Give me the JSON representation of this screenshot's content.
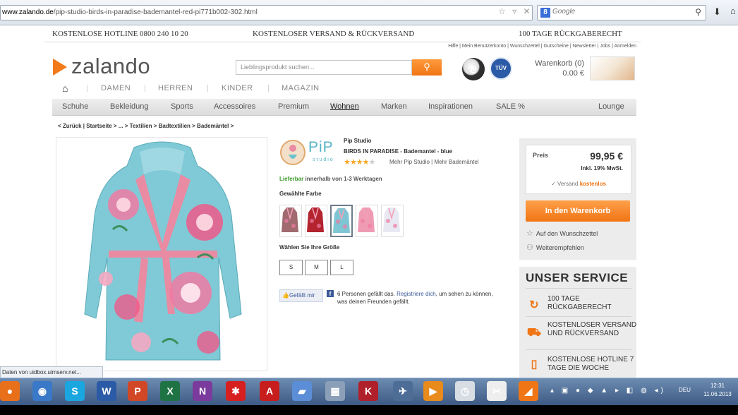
{
  "browser": {
    "url_domain": "www.zalando.de",
    "url_path": "/pip-studio-birds-in-paradise-bademantel-red-pi771b002-302.html",
    "search_engine": "Google",
    "status_text": "Daten von uidbox.uimserv.net..."
  },
  "promo": {
    "hotline": "KOSTENLOSE HOTLINE 0800 240 10 20",
    "shipping": "KOSTENLOSER VERSAND & RÜCKVERSAND",
    "return": "100 TAGE RÜCKGABERECHT"
  },
  "toplinks": "Hilfe | Mein Benutzerkonto | Wunschzettel | Gutscheine | Newsletter | Jobs | Anmelden",
  "header": {
    "logo": "zalando",
    "search_placeholder": "Lieblingsprodukt suchen...",
    "tuv_label": "TÜV",
    "e_label": "e",
    "cart_label": "Warenkorb (0)",
    "cart_amount": "0.00 €"
  },
  "category_nav": [
    "DAMEN",
    "HERREN",
    "KINDER",
    "MAGAZIN"
  ],
  "main_nav": [
    "Schuhe",
    "Bekleidung",
    "Sports",
    "Accessoires",
    "Premium",
    "Wohnen",
    "Marken",
    "Inspirationen",
    "SALE %",
    "Lounge"
  ],
  "breadcrumb": "< Zurück |  Startseite > ... > Textilien > Badtextilien > Bademäntel >",
  "product": {
    "brand_logo": "PiP",
    "brand_logo_sub": "studio",
    "brand": "Pip Studio",
    "title": "BIRDS IN PARADISE - Bademantel - blue",
    "rating": 4,
    "rating_max": 5,
    "more_links": "Mehr Pip Studio | Mehr Bademäntel",
    "availability_label": "Lieferbar",
    "availability_text": " innerhalb von 1-3 Werktagen",
    "color_label": "Gewählte Farbe",
    "size_label": "Wählen Sie Ihre Größe",
    "sizes": [
      "S",
      "M",
      "L"
    ],
    "swatch_colors": [
      "#a06a6f",
      "#b3242f",
      "#7ec6d4",
      "#f09bb4",
      "#e8e8f2"
    ],
    "selected_swatch": 2
  },
  "facebook": {
    "like_label": "Gefällt mir",
    "text_before": "6 Personen gefällt das. ",
    "link": "Registriere dich",
    "text_after": ", um sehen zu können, was deinen Freunden gefällt."
  },
  "pricebox": {
    "price_label": "Preis",
    "price": "99,95 €",
    "vat": "Inkl. 19% MwSt.",
    "shipping_label": "Versand ",
    "shipping_free": "kostenlos",
    "cart_button": "In den Warenkorb",
    "wishlist": "Auf den Wunschzettel",
    "recommend": "Weiterempfehlen"
  },
  "service": {
    "title": "UNSER SERVICE",
    "items": [
      "100 TAGE RÜCKGABERECHT",
      "KOSTENLOSER VERSAND UND RÜCKVERSAND",
      "KOSTENLOSE HOTLINE 7 TAGE DIE WOCHE"
    ]
  },
  "taskbar": {
    "apps": [
      {
        "name": "firefox-icon",
        "color": "#e8701b",
        "glyph": "●"
      },
      {
        "name": "thunderbird-icon",
        "color": "#3a78c8",
        "glyph": "◉"
      },
      {
        "name": "skype-icon",
        "color": "#1aa7e0",
        "glyph": "S"
      },
      {
        "name": "word-icon",
        "color": "#2b5aa6",
        "glyph": "W"
      },
      {
        "name": "powerpoint-icon",
        "color": "#d24726",
        "glyph": "P"
      },
      {
        "name": "excel-icon",
        "color": "#1f7244",
        "glyph": "X"
      },
      {
        "name": "onenote-icon",
        "color": "#7a3b9c",
        "glyph": "N"
      },
      {
        "name": "puzzle-icon",
        "color": "#d62020",
        "glyph": "✱"
      },
      {
        "name": "acrobat-icon",
        "color": "#c81d1d",
        "glyph": "A"
      },
      {
        "name": "notes-icon",
        "color": "#5b8ed6",
        "glyph": "▰"
      },
      {
        "name": "calculator-icon",
        "color": "#8ba0b8",
        "glyph": "▦"
      },
      {
        "name": "kaspersky-icon",
        "color": "#b0202a",
        "glyph": "K"
      },
      {
        "name": "plane-icon",
        "color": "#4d6d96",
        "glyph": "✈"
      },
      {
        "name": "media-player-icon",
        "color": "#e88a1c",
        "glyph": "▶"
      },
      {
        "name": "clock-icon",
        "color": "#d8dde3",
        "glyph": "◷"
      },
      {
        "name": "snipping-icon",
        "color": "#eeeeee",
        "glyph": "✂"
      },
      {
        "name": "zalando-app-icon",
        "color": "#f07515",
        "glyph": "◢"
      }
    ],
    "tray": "▴ ▣ ● ◆ ▲ ▸ ◧ ◍ ◂)",
    "language": "DEU",
    "time": "12:31",
    "date": "11.06.2013"
  }
}
